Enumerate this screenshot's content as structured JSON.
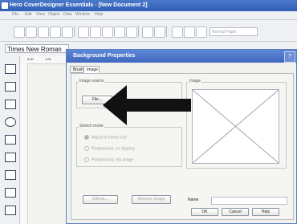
{
  "app": {
    "title": "Hero CoverDesigner Essentials - [New Document 2]"
  },
  "menu": [
    "File",
    "Edit",
    "View",
    "Object",
    "Data",
    "Window",
    "Help"
  ],
  "toolbar": {
    "paper_label": "Normal Paper"
  },
  "format": {
    "font_value": "Times New Roman"
  },
  "ruler": {
    "marks": [
      "0.00",
      "1.00"
    ]
  },
  "dialog": {
    "title": "Background Properties",
    "help": "?",
    "tabs": [
      "Brush",
      "Image"
    ],
    "image_source_label": "Image source",
    "file_button": "File...",
    "stretch_mode_label": "Stretch mode",
    "stretch_options": [
      "Adjust to frame size",
      "Proportional, no clipping",
      "Proportional, clip image"
    ],
    "image_label": "Image",
    "effects_button": "Effects...",
    "remove_image_button": "Remove Image",
    "name_label": "Name",
    "name_value": "",
    "ok_button": "OK",
    "cancel_button": "Cancel",
    "help_button": "Help"
  },
  "colors": {
    "title_blue": "#2f5fb7",
    "arrow_black": "#111111",
    "preview_line": "#9ea5b0"
  }
}
